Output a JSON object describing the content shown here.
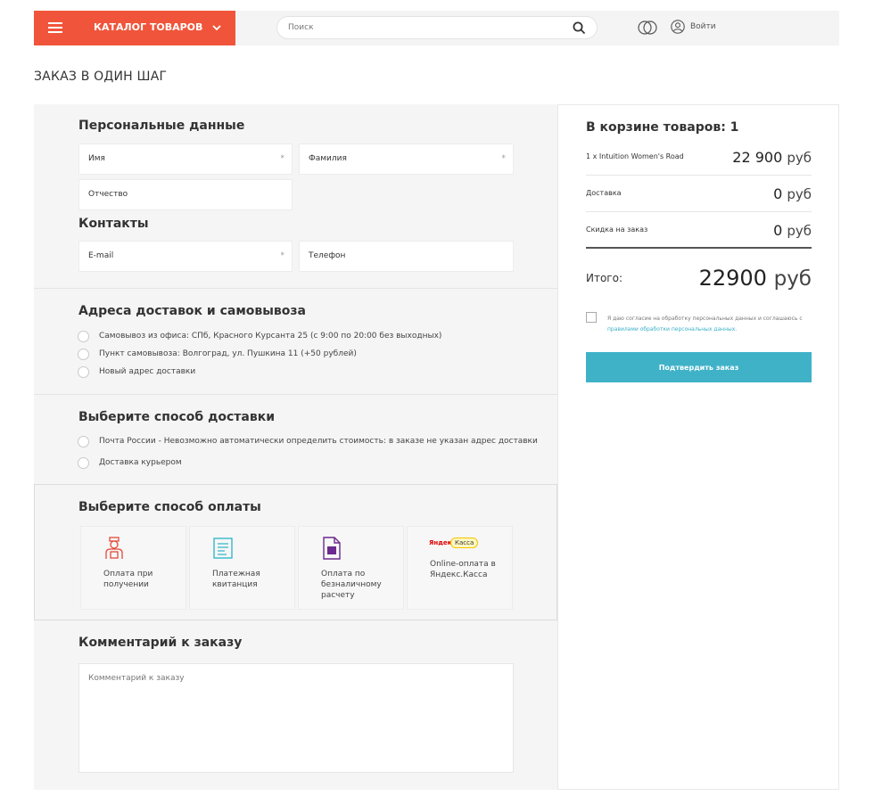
{
  "header": {
    "catalog_label": "КАТАЛОГ ТОВАРОВ",
    "search_placeholder": "Поиск",
    "login_label": "Войти",
    "brand_color": "#f0553b"
  },
  "page_title": "ЗАКАЗ В ОДИН ШАГ",
  "personal": {
    "title": "Персональные данные",
    "first_name": "Имя",
    "last_name": "Фамилия",
    "patronymic": "Отчество",
    "required_mark": "*"
  },
  "contacts": {
    "title": "Контакты",
    "email": "E-mail",
    "phone": "Телефон"
  },
  "addresses": {
    "title": "Адреса доставок и самовывоза",
    "options": [
      "Самовывоз из офиса: СПб, Красного Курсанта 25 (с 9:00 по 20:00 без выходных)",
      "Пункт самовывоза: Волгоград, ул. Пушкина 11 (+50 рублей)",
      "Новый адрес доставки"
    ]
  },
  "delivery": {
    "title": "Выберите способ доставки",
    "options": [
      "Почта России -  Невозможно автоматически определить стоимость: в заказе не указан адрес доставки",
      "Доставка курьером"
    ]
  },
  "payment": {
    "title": "Выберите способ оплаты",
    "options": [
      {
        "label": "Оплата при получении",
        "icon": "courier-icon"
      },
      {
        "label": "Платежная квитанция",
        "icon": "receipt-icon"
      },
      {
        "label": "Оплата по безналичному расчету",
        "icon": "invoice-icon"
      },
      {
        "label": "Online-оплата в Яндекс.Касса",
        "icon": "yandex-kassa-logo",
        "logo_left": "Яндекс",
        "logo_right": "Касса"
      }
    ]
  },
  "comment": {
    "title": "Комментарий к заказу",
    "placeholder": "Комментарий к заказу"
  },
  "cart": {
    "title": "В корзине товаров: 1",
    "rows": [
      {
        "label": "1 x Intuition Women's Road",
        "value": "22 900",
        "currency": "руб"
      },
      {
        "label": "Доставка",
        "value": "0",
        "currency": "руб"
      },
      {
        "label": "Скидка на заказ",
        "value": "0",
        "currency": "руб"
      }
    ],
    "total_label": "Итого:",
    "total_value": "22900",
    "total_currency": "руб",
    "agree_text": "Я даю согласие на обработку персональных данных и соглашаюсь с",
    "agree_link": "правилами обработки персональных данных.",
    "confirm_label": "Подтвердить заказ",
    "accent_color": "#3fb2c8"
  }
}
